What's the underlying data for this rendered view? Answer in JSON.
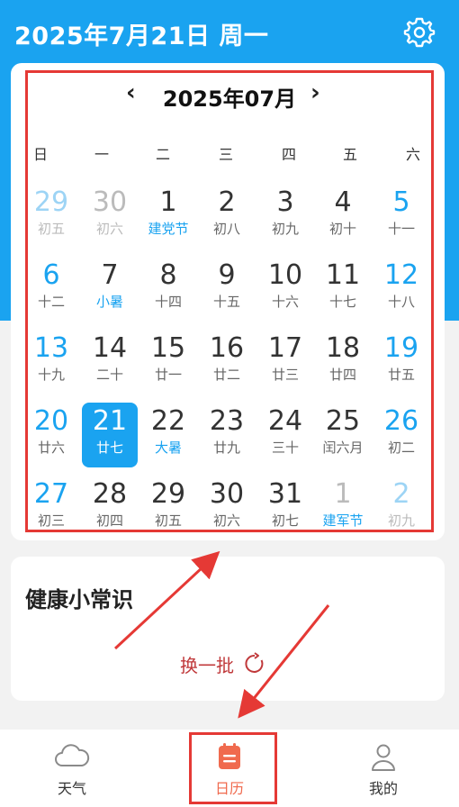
{
  "header": {
    "date_title": "2025年7月21日 周一"
  },
  "calendar": {
    "month_title": "2025年07月",
    "prev_label": "‹",
    "next_label": "›",
    "weekdays": [
      "日",
      "一",
      "二",
      "三",
      "四",
      "五",
      "六"
    ],
    "weeks": [
      [
        {
          "num": "29",
          "lunar": "初五",
          "style": "lightblue"
        },
        {
          "num": "30",
          "lunar": "初六",
          "style": "gray"
        },
        {
          "num": "1",
          "lunar": "建党节",
          "style": "dark",
          "festival": true
        },
        {
          "num": "2",
          "lunar": "初八",
          "style": "dark"
        },
        {
          "num": "3",
          "lunar": "初九",
          "style": "dark"
        },
        {
          "num": "4",
          "lunar": "初十",
          "style": "dark"
        },
        {
          "num": "5",
          "lunar": "十一",
          "style": "blue"
        }
      ],
      [
        {
          "num": "6",
          "lunar": "十二",
          "style": "blue"
        },
        {
          "num": "7",
          "lunar": "小暑",
          "style": "dark",
          "festival": true
        },
        {
          "num": "8",
          "lunar": "十四",
          "style": "dark"
        },
        {
          "num": "9",
          "lunar": "十五",
          "style": "dark"
        },
        {
          "num": "10",
          "lunar": "十六",
          "style": "dark"
        },
        {
          "num": "11",
          "lunar": "十七",
          "style": "dark"
        },
        {
          "num": "12",
          "lunar": "十八",
          "style": "blue"
        }
      ],
      [
        {
          "num": "13",
          "lunar": "十九",
          "style": "blue"
        },
        {
          "num": "14",
          "lunar": "二十",
          "style": "dark"
        },
        {
          "num": "15",
          "lunar": "廿一",
          "style": "dark"
        },
        {
          "num": "16",
          "lunar": "廿二",
          "style": "dark"
        },
        {
          "num": "17",
          "lunar": "廿三",
          "style": "dark"
        },
        {
          "num": "18",
          "lunar": "廿四",
          "style": "dark"
        },
        {
          "num": "19",
          "lunar": "廿五",
          "style": "blue"
        }
      ],
      [
        {
          "num": "20",
          "lunar": "廿六",
          "style": "blue"
        },
        {
          "num": "21",
          "lunar": "廿七",
          "style": "dark",
          "selected": true
        },
        {
          "num": "22",
          "lunar": "大暑",
          "style": "dark",
          "festival": true
        },
        {
          "num": "23",
          "lunar": "廿九",
          "style": "dark"
        },
        {
          "num": "24",
          "lunar": "三十",
          "style": "dark"
        },
        {
          "num": "25",
          "lunar": "闰六月",
          "style": "dark"
        },
        {
          "num": "26",
          "lunar": "初二",
          "style": "blue"
        }
      ],
      [
        {
          "num": "27",
          "lunar": "初三",
          "style": "blue"
        },
        {
          "num": "28",
          "lunar": "初四",
          "style": "dark"
        },
        {
          "num": "29",
          "lunar": "初五",
          "style": "dark"
        },
        {
          "num": "30",
          "lunar": "初六",
          "style": "dark"
        },
        {
          "num": "31",
          "lunar": "初七",
          "style": "dark"
        },
        {
          "num": "1",
          "lunar": "建军节",
          "style": "gray",
          "festival": true
        },
        {
          "num": "2",
          "lunar": "初九",
          "style": "lightblue"
        }
      ]
    ]
  },
  "health": {
    "title": "健康小常识",
    "refresh_label": "换一批"
  },
  "tabbar": {
    "weather": "天气",
    "calendar": "日历",
    "mine": "我的"
  },
  "colors": {
    "primary": "#1aa3f0",
    "accent_red": "#e53935",
    "tab_active": "#f06a4e"
  },
  "icons": [
    "gear-icon",
    "cloud-icon",
    "calendar-icon",
    "person-icon",
    "refresh-icon",
    "chevron-left-icon",
    "chevron-right-icon"
  ]
}
